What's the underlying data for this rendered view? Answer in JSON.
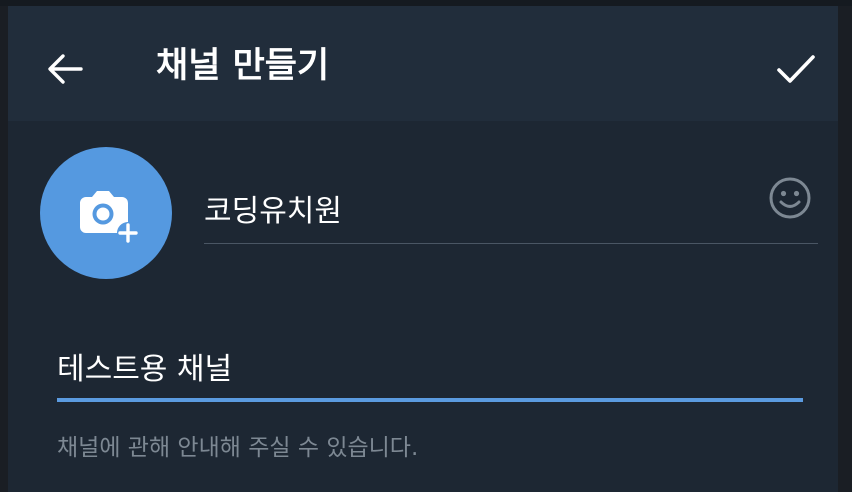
{
  "header": {
    "title": "채널 만들기",
    "back_icon": "arrow-left-icon",
    "done_icon": "checkmark-icon"
  },
  "avatar": {
    "icon": "add-photo-icon",
    "color": "#5599e0"
  },
  "channel_name": {
    "value": "코딩유치원",
    "emoji_icon": "smiley-icon"
  },
  "description": {
    "value": "테스트용 채널",
    "hint": "채널에 관해 안내해 주실 수 있습니다.",
    "accent": "#5b9be0"
  },
  "colors": {
    "background": "#1d2733",
    "header": "#212d3b",
    "hint_text": "#7d8893"
  }
}
